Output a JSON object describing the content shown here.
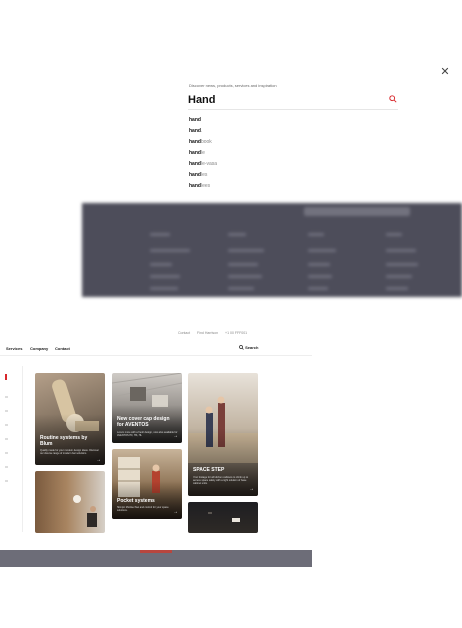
{
  "search": {
    "prompt": "Discover news, products, services and inspiration",
    "query": "Hand",
    "close_icon": "close-icon",
    "search_icon": "search-icon",
    "accent_color": "#d8282c",
    "suggestions": [
      {
        "match": "hand",
        "rest": ""
      },
      {
        "match": "hand",
        "rest": "."
      },
      {
        "match": "hand",
        "rest": "book"
      },
      {
        "match": "hand",
        "rest": "le"
      },
      {
        "match": "hand",
        "rest": "le-vasa"
      },
      {
        "match": "hand",
        "rest": "les"
      },
      {
        "match": "hand",
        "rest": "lees"
      }
    ]
  },
  "page": {
    "topline": [
      "Contact",
      "Find Harrison",
      "+1 00 FFF001"
    ],
    "nav": {
      "services": "Services",
      "company": "Company",
      "contact": "Contact",
      "search": "Search"
    },
    "cards": [
      {
        "title": "Routine systems by Blum",
        "text": "Quality made for your modern design ideas. Discover our diverse range of modern bar solutions."
      },
      {
        "title": "New cover cap design for AVENTOS",
        "text": "Lorem more with a fresh design, now also available for AVENTOS HF, HS, HL"
      },
      {
        "title": "SPACE STEP",
        "text": "Your footage for all kitchen cabinets to climb up to access space safely with a right solution of base cabinet units."
      },
      {
        "title": "Pocket systems",
        "text": "Slimpic Mortise flow and control for your space solutions."
      }
    ]
  }
}
